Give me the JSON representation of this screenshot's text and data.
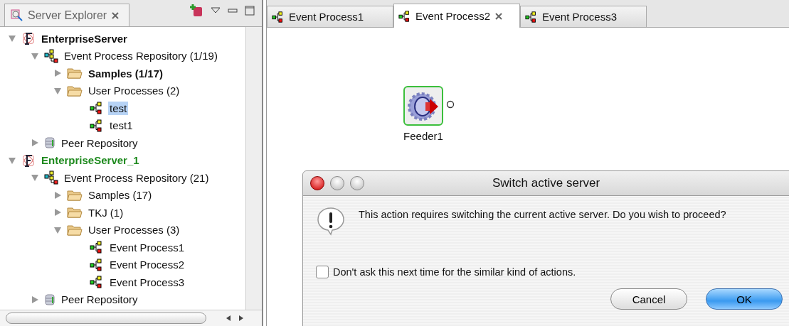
{
  "explorer": {
    "title": "Server Explorer",
    "tree": [
      {
        "kind": "server",
        "label": "EnterpriseServer",
        "active": false,
        "expanded": true,
        "selected": false,
        "children": [
          {
            "kind": "repository",
            "label": "Event Process Repository (1/19)",
            "expanded": true,
            "selected": false,
            "children": [
              {
                "kind": "folder",
                "label": "Samples (1/17)",
                "bold": true,
                "expanded": false,
                "selected": false
              },
              {
                "kind": "folder",
                "label": "User Processes (2)",
                "bold": false,
                "expanded": true,
                "selected": false,
                "children": [
                  {
                    "kind": "process",
                    "label": "test",
                    "selected": true
                  },
                  {
                    "kind": "process",
                    "label": "test1",
                    "selected": false
                  }
                ]
              }
            ]
          },
          {
            "kind": "peer",
            "label": "Peer Repository",
            "expanded": false,
            "selected": false
          }
        ]
      },
      {
        "kind": "server",
        "label": "EnterpriseServer_1",
        "active": true,
        "expanded": true,
        "selected": false,
        "children": [
          {
            "kind": "repository",
            "label": "Event Process Repository (21)",
            "expanded": true,
            "selected": false,
            "children": [
              {
                "kind": "folder",
                "label": "Samples (17)",
                "bold": false,
                "expanded": false,
                "selected": false
              },
              {
                "kind": "folder",
                "label": "TKJ (1)",
                "bold": false,
                "expanded": false,
                "selected": false
              },
              {
                "kind": "folder",
                "label": "User Processes (3)",
                "bold": false,
                "expanded": true,
                "selected": false,
                "children": [
                  {
                    "kind": "process",
                    "label": "Event Process1",
                    "selected": false
                  },
                  {
                    "kind": "process",
                    "label": "Event Process2",
                    "selected": false
                  },
                  {
                    "kind": "process",
                    "label": "Event Process3",
                    "selected": false
                  }
                ]
              }
            ]
          },
          {
            "kind": "peer",
            "label": "Peer Repository",
            "expanded": false,
            "selected": false
          }
        ]
      }
    ]
  },
  "editor": {
    "tabs": [
      {
        "label": "Event Process1",
        "selected": false
      },
      {
        "label": "Event Process2",
        "selected": true
      },
      {
        "label": "Event Process3",
        "selected": false
      }
    ],
    "nodes": [
      {
        "label": "Feeder1"
      }
    ]
  },
  "dialog": {
    "title": "Switch active server",
    "message": "This action requires switching the current active server. Do you wish to proceed?",
    "checkbox": {
      "label": "Don't ask this next time for the similar kind of actions.",
      "checked": false
    },
    "buttons": [
      {
        "label": "Cancel",
        "default": false
      },
      {
        "label": "OK",
        "default": true
      }
    ]
  }
}
